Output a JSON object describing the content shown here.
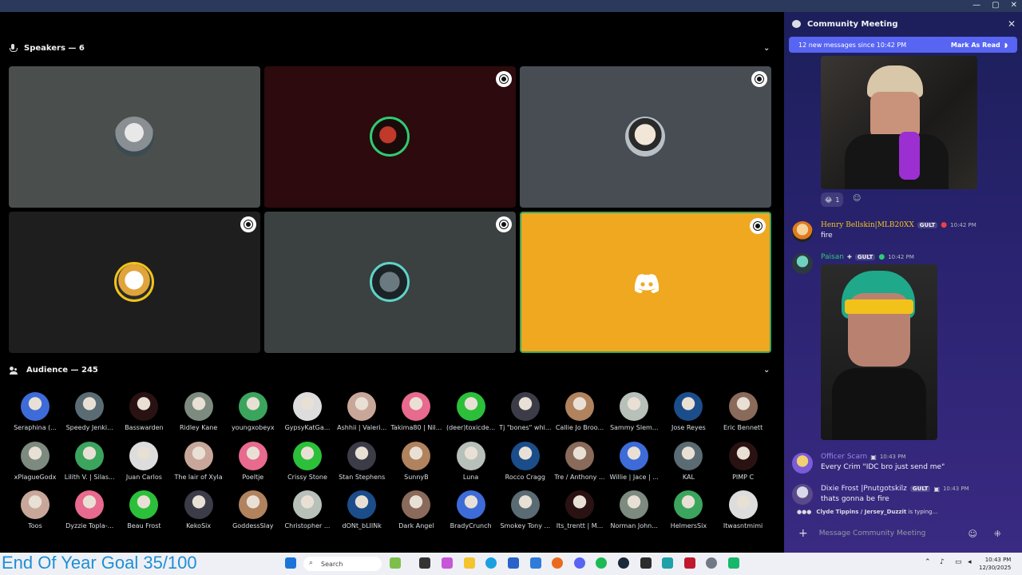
{
  "window": {
    "controls": [
      "—",
      "▢",
      "✕"
    ]
  },
  "speakers": {
    "label": "Speakers — 6"
  },
  "audience": {
    "label": "Audience — 245",
    "members": [
      [
        "Seraphina (...",
        "Speedy Jenki...",
        "Basswarden",
        "Ridley Kane",
        "youngxobeyx",
        "GypsyKatGa...",
        "Ashhii | Valeri...",
        "Takima80 | Nil...",
        "(deer)toxicde...",
        "Tj \"bones\" whi...",
        "Callie Jo Broo...",
        "Sammy Slem...",
        "Jose Reyes",
        "Eric Bennett"
      ],
      [
        "xPlagueGodx",
        "Lilith V. | Silas...",
        "Juan Carlos",
        "The lair of Xyla",
        "Poeltje",
        "Crissy Stone",
        "Stan Stephens",
        "SunnyB",
        "Luna",
        "Rocco Cragg",
        "Tre / Anthony ...",
        "Willie | Jace | ...",
        "KAL",
        "PIMP C"
      ],
      [
        "Toos",
        "Dyzzie Topla-...",
        "Beau Frost",
        "KekoSix",
        "GoddessSlay",
        "Christopher ...",
        "dONt_bLIINk",
        "Dark Angel",
        "BradyCrunch",
        "Smokey Tony ...",
        "Its_trentt | M...",
        "Norman John...",
        "HelmersSix",
        "Itwasntmimi"
      ]
    ]
  },
  "chat": {
    "title": "Community Meeting",
    "banner": {
      "text": "12 new messages since 10:42 PM",
      "action": "Mark As Read"
    },
    "reaction_count": "1",
    "messages": [
      {
        "author": "Henry Bellskin|MLB20XX",
        "tag": "GULT",
        "time": "10:42 PM",
        "text": "fire",
        "color": "#f0c419"
      },
      {
        "author": "Paisan",
        "tag": "GULT",
        "time": "10:42 PM",
        "text": "",
        "color": "#2ecc71"
      },
      {
        "author": "Officer Scarn",
        "tag": "",
        "time": "10:43 PM",
        "text": "Every Crim \"IDC bro just send me\"",
        "color": "#9b84ee"
      },
      {
        "author": "Dixie Frost |Pnutgotskilz",
        "tag": "GULT",
        "time": "10:43 PM",
        "text": "thats gonna be fire",
        "color": "#e8e8ff"
      }
    ],
    "typing": {
      "names": "Clyde Tippins / Jersey_Duzzit",
      "suffix": "is typing..."
    },
    "composer_placeholder": "Message Community Meeting"
  },
  "overlay": {
    "goal": "End Of Year Goal 35/100"
  },
  "taskbar": {
    "search": "Search",
    "time": "10:43 PM",
    "date": "12/30/2025"
  },
  "colors": {
    "discord_tile": "#f0a820",
    "blurple": "#5865f2"
  }
}
